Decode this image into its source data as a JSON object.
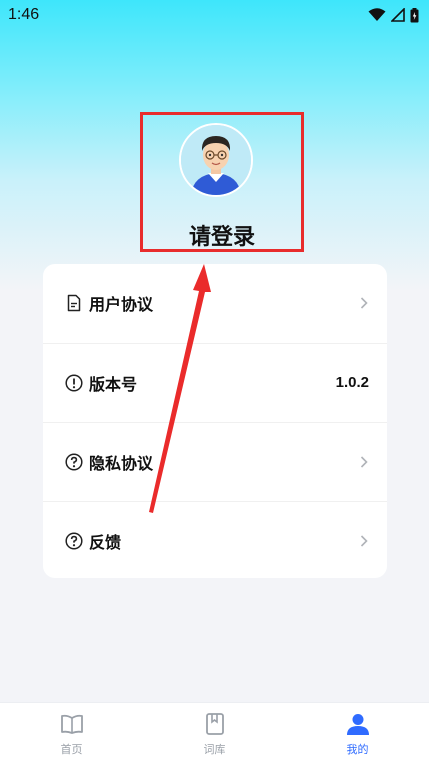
{
  "status_bar": {
    "time": "1:46"
  },
  "profile": {
    "login_label": "请登录"
  },
  "menu": {
    "items": [
      {
        "label": "用户协议",
        "icon": "document-icon",
        "value": ""
      },
      {
        "label": "版本号",
        "icon": "info-icon",
        "value": "1.0.2"
      },
      {
        "label": "隐私协议",
        "icon": "question-icon",
        "value": ""
      },
      {
        "label": "反馈",
        "icon": "question-icon",
        "value": ""
      }
    ]
  },
  "bottom_nav": {
    "items": [
      {
        "label": "首页",
        "icon": "book-open-icon"
      },
      {
        "label": "词库",
        "icon": "bookmark-book-icon"
      },
      {
        "label": "我的",
        "icon": "user-icon",
        "active": true
      }
    ]
  },
  "colors": {
    "accent": "#2f6bff",
    "highlight": "#e82c2c"
  }
}
